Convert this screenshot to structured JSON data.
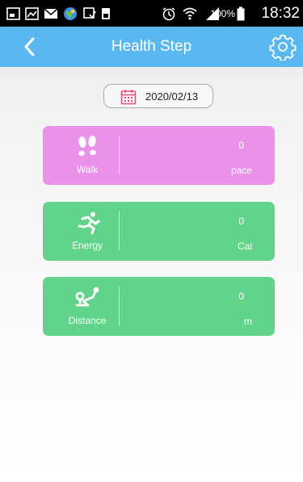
{
  "status_bar": {
    "battery_percent": "100%",
    "time": "18:32",
    "icons": [
      "notification-icon",
      "gallery-icon",
      "messages-icon",
      "browser-icon",
      "download-icon",
      "sim-icon",
      "alarm-icon",
      "wifi-icon",
      "signal-icon",
      "battery-icon"
    ]
  },
  "header": {
    "title": "Health Step",
    "back_icon": "chevron-left-icon",
    "settings_icon": "gear-icon",
    "color": "#5bb7f0"
  },
  "date_picker": {
    "date": "2020/02/13",
    "icon": "calendar-icon",
    "icon_color": "#e9447f"
  },
  "cards": [
    {
      "label": "Walk",
      "value": "0",
      "unit": "pace",
      "icon": "footsteps-icon",
      "color": "#ec91ea"
    },
    {
      "label": "Energy",
      "value": "0",
      "unit": "Cal",
      "icon": "running-person-icon",
      "color": "#62d38a"
    },
    {
      "label": "Distance",
      "value": "0",
      "unit": "m",
      "icon": "route-icon",
      "color": "#62d38a"
    }
  ]
}
